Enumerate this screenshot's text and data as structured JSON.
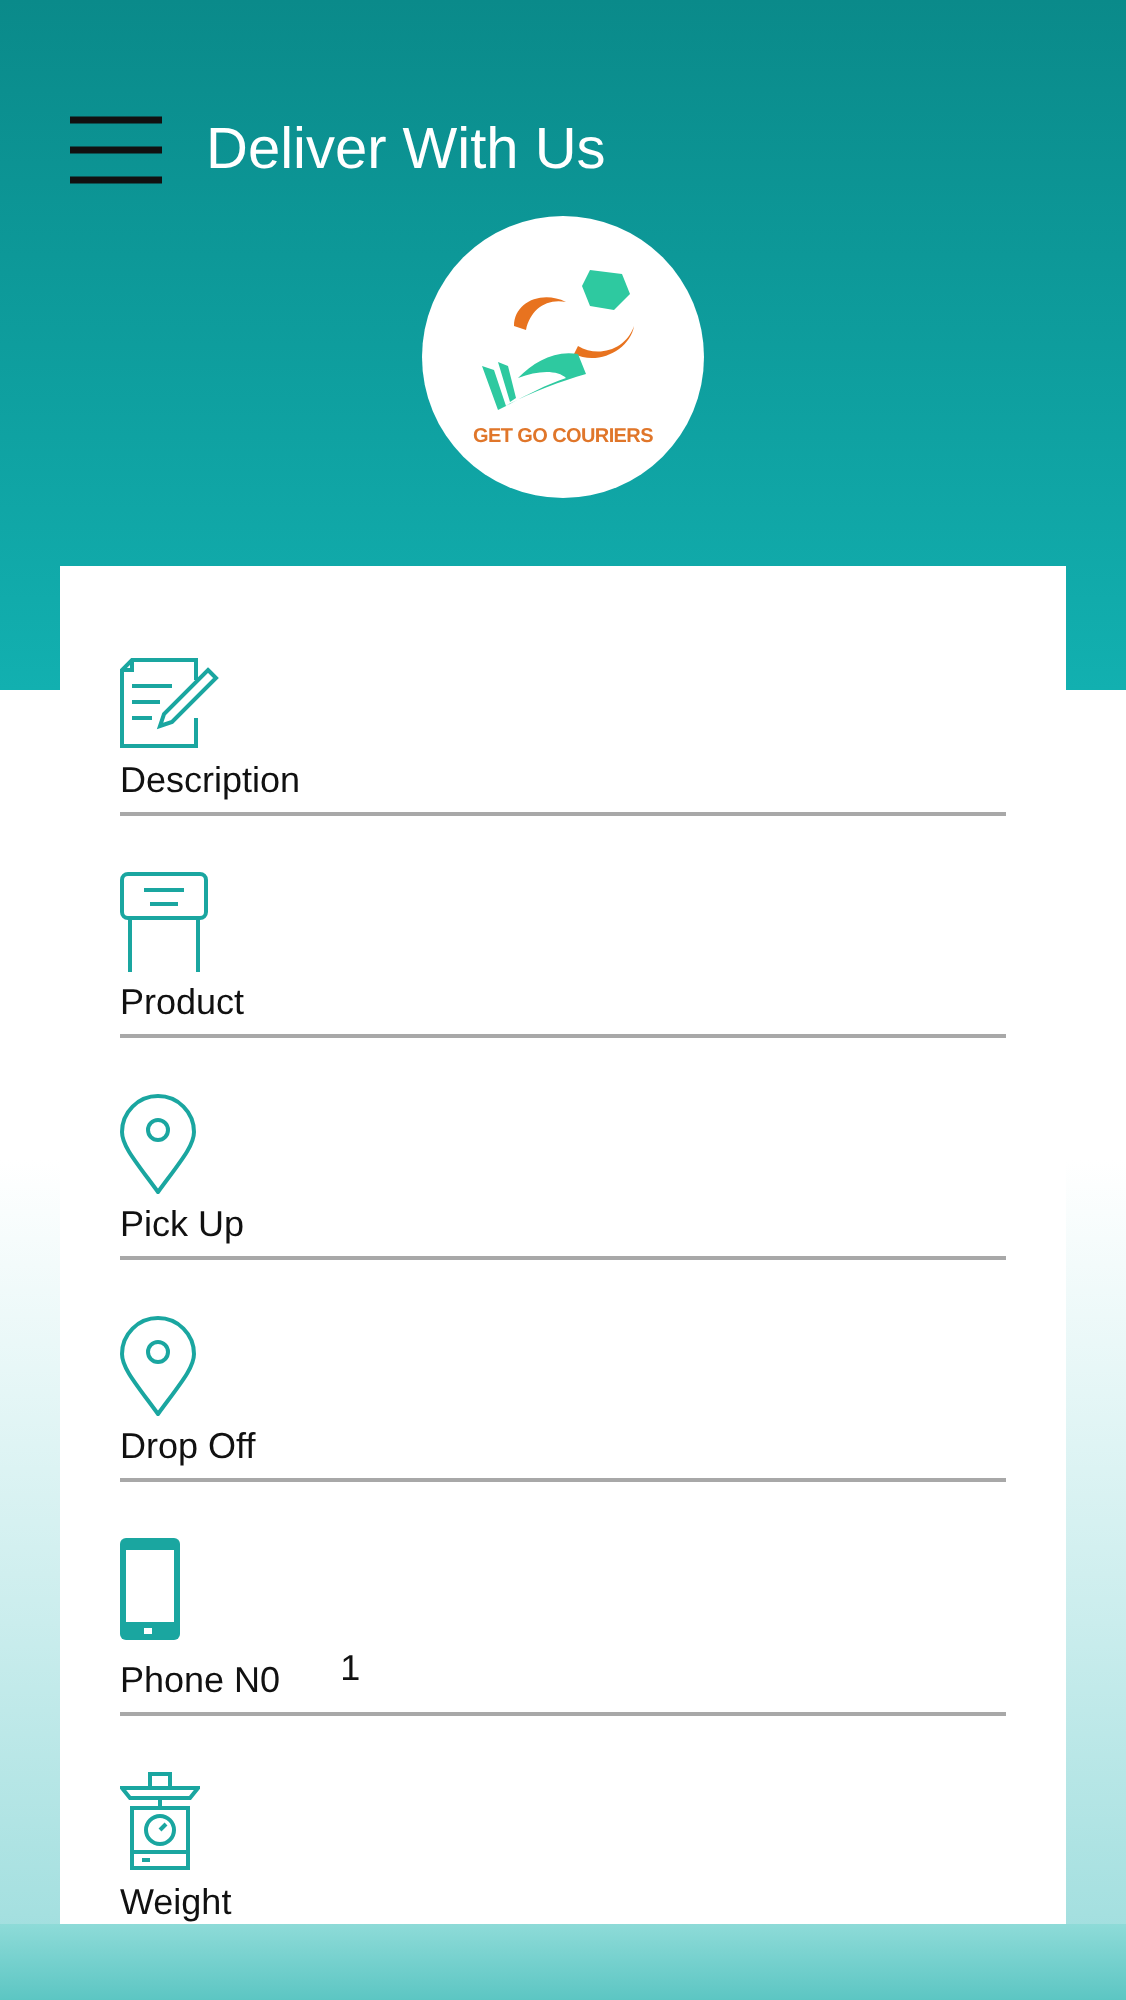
{
  "header": {
    "title": "Deliver With Us"
  },
  "logo": {
    "text": "GET GO COURIERS"
  },
  "fields": [
    {
      "kind": "note",
      "label": "Description"
    },
    {
      "kind": "sign",
      "label": "Product"
    },
    {
      "kind": "pin",
      "label": "Pick Up"
    },
    {
      "kind": "pin",
      "label": "Drop Off"
    },
    {
      "kind": "phone",
      "label": "Phone N0",
      "value": "1"
    },
    {
      "kind": "scale",
      "label": "Weight"
    }
  ]
}
